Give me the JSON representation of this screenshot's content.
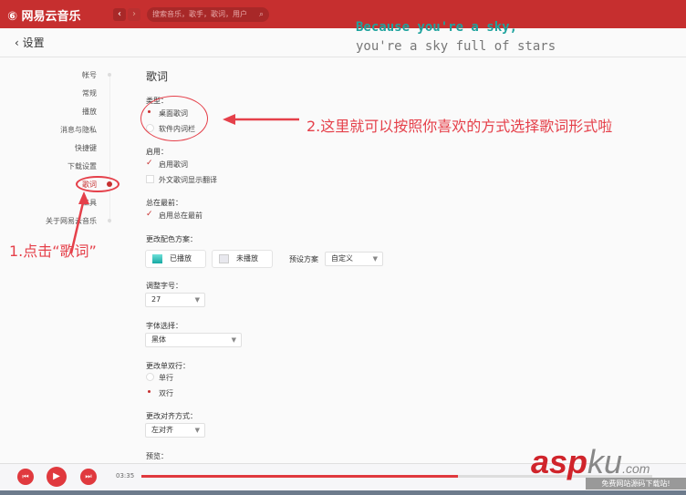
{
  "app": {
    "title": "网易云音乐",
    "search_placeholder": "搜索音乐，歌手，歌词，用户"
  },
  "lyrics_preview": {
    "line1": "Because you're a sky,",
    "line2": "you're a sky full of stars"
  },
  "page": {
    "back_label": "设置",
    "section_title": "歌词"
  },
  "sidebar": {
    "items": [
      "帐号",
      "常规",
      "播放",
      "消息与隐私",
      "快捷键",
      "下载设置",
      "歌词",
      "工具",
      "关于网易云音乐"
    ],
    "active": "歌词"
  },
  "settings": {
    "type_label": "类型：",
    "type_options": [
      "桌面歌词",
      "软件内词栏"
    ],
    "type_selected": "桌面歌词",
    "enable_label": "启用：",
    "enable_lyrics": "启用歌词",
    "enable_lyrics_checked": true,
    "foreign_translate": "外文歌词显示翻译",
    "foreign_translate_checked": false,
    "ontop_label": "总在最前：",
    "ontop_option": "启用总在最前",
    "ontop_checked": true,
    "color_label": "更改配色方案：",
    "played": "已播放",
    "unplayed": "未播放",
    "preset_label": "预设方案",
    "preset_value": "自定义",
    "fontsize_label": "调整字号：",
    "fontsize_value": "27",
    "font_label": "字体选择：",
    "font_value": "黑体",
    "lines_label": "更改单双行：",
    "lines_options": [
      "单行",
      "双行"
    ],
    "lines_selected": "双行",
    "align_label": "更改对齐方式：",
    "align_value": "左对齐",
    "preview_label": "预览："
  },
  "player": {
    "time": "03:35",
    "progress": 0.62
  },
  "annotations": {
    "step1": "1.点击“歌词”",
    "step2": "2.这里就可以按照你喜欢的方式选择歌词形式啦"
  },
  "watermark": {
    "brand": "aspku.com",
    "tagline": "免费网站源码下载站!"
  },
  "colors": {
    "accent": "#c62f2f",
    "annotation": "#e5404a",
    "played": "#1ea39e"
  }
}
